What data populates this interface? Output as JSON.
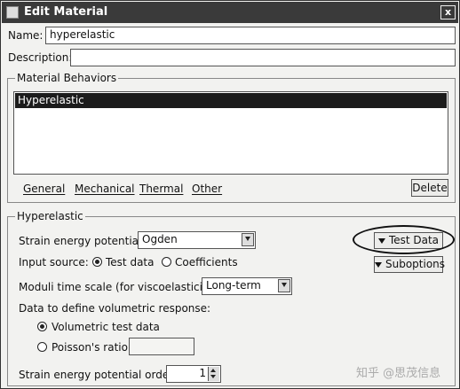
{
  "window": {
    "title": "Edit Material",
    "close_label": "x"
  },
  "name": {
    "label": "Name:",
    "value": "hyperelastic"
  },
  "description": {
    "label": "Description:",
    "value": ""
  },
  "behaviors": {
    "title": "Material Behaviors",
    "items": [
      "Hyperelastic"
    ],
    "menus": [
      "General",
      "Mechanical",
      "Thermal",
      "Other"
    ],
    "delete_label": "Delete"
  },
  "hyper": {
    "title": "Hyperelastic",
    "sep_label": "Strain energy potential:",
    "sep_value": "Ogden",
    "input_label": "Input source:",
    "input_options": [
      "Test data",
      "Coefficients"
    ],
    "input_selected": "Test data",
    "moduli_label": "Moduli time scale (for viscoelasticity):",
    "moduli_value": "Long-term",
    "vol_label": "Data to define volumetric response:",
    "vol_options": [
      "Volumetric test data",
      "Poisson's ratio:"
    ],
    "vol_selected": "Volumetric test data",
    "poisson_value": "",
    "order_label": "Strain energy potential order:",
    "order_value": "1",
    "test_data_label": "Test Data",
    "suboptions_label": "Suboptions"
  },
  "watermark": "知乎 @思茂信息"
}
